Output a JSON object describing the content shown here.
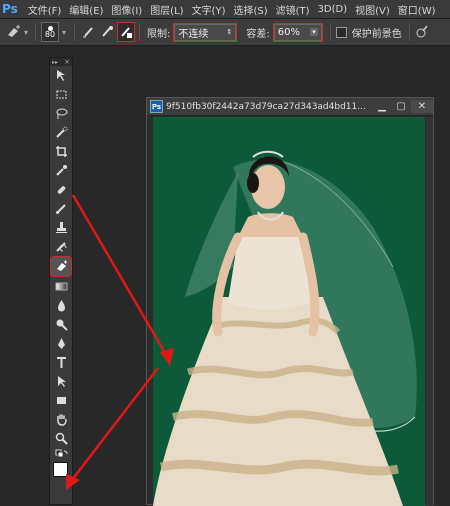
{
  "app": {
    "logo": "Ps"
  },
  "menu": [
    "文件(F)",
    "编辑(E)",
    "图像(I)",
    "图层(L)",
    "文字(Y)",
    "选择(S)",
    "滤镜(T)",
    "3D(D)",
    "视图(V)",
    "窗口(W)"
  ],
  "options": {
    "brush_size": "80",
    "limit_label": "限制:",
    "limit_value": "不连续",
    "tolerance_label": "容差:",
    "tolerance_value": "60%",
    "protect_label": "保护前景色"
  },
  "document": {
    "title": "9f510fb30f2442a73d79ca27d343ad4bd11...",
    "icon_text": "Ps"
  },
  "colors": {
    "accent": "#d02a2a",
    "canvas_bg": "#0c5a3a",
    "ps_blue": "#4fa9ff"
  },
  "icons": [
    "background-eraser-tool-icon",
    "brush-preview-icon",
    "sampling-continuous-icon",
    "sampling-once-icon",
    "sampling-swatch-icon",
    "pressure-icon"
  ]
}
